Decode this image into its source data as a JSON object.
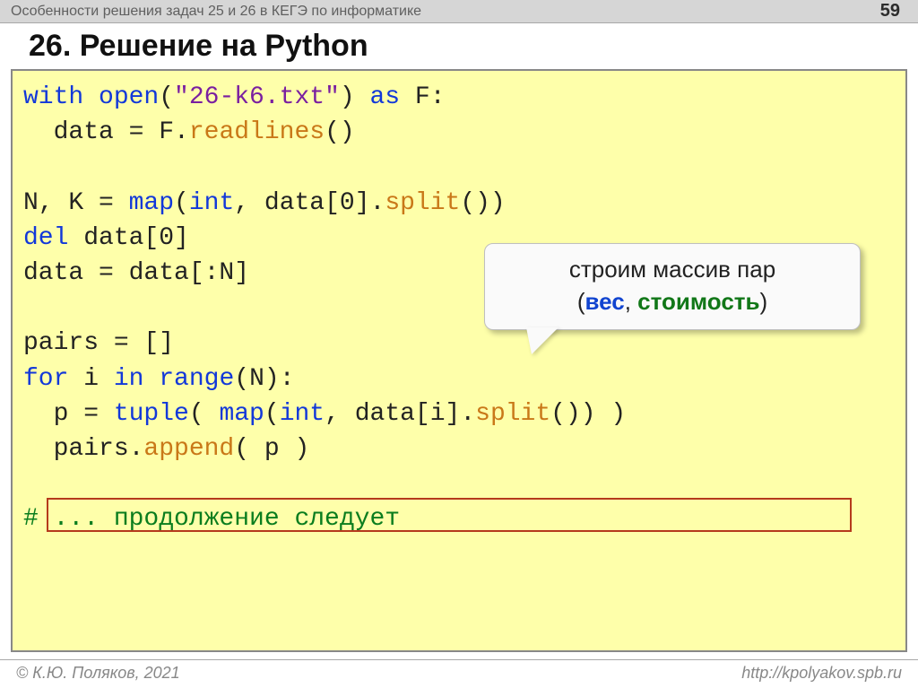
{
  "header": {
    "title": "Особенности решения задач 25 и 26 в КЕГЭ по информатике",
    "page": "59"
  },
  "title": "26. Решение на Python",
  "code": {
    "l1a": "with",
    "l1b": " open",
    "l1c": "(",
    "l1d": "\"26-k6.txt\"",
    "l1e": ")",
    "l1f": " as",
    "l1g": " F:",
    "l2a": "  data = F.",
    "l2b": "readlines",
    "l2c": "()",
    "l4a": "N, K = ",
    "l4b": "map",
    "l4c": "(",
    "l4d": "int",
    "l4e": ", data[0].",
    "l4f": "split",
    "l4g": "())",
    "l5a": "del",
    "l5b": " data[0]",
    "l6a": "data = data[:N]",
    "l8a": "pairs = []",
    "l9a": "for",
    "l9b": " i ",
    "l9c": "in",
    "l9d": " range",
    "l9e": "(N):",
    "l10a": "  p = ",
    "l10b": "tuple",
    "l10c": "( ",
    "l10d": "map",
    "l10e": "(",
    "l10f": "int",
    "l10g": ", data[i].",
    "l10h": "split",
    "l10i": "()) )",
    "l11a": "  pairs.",
    "l11b": "append",
    "l11c": "( p )",
    "l13a": "# ... продолжение следует"
  },
  "callout": {
    "line1": "строим массив пар",
    "p_open": "(",
    "w1": "вес",
    "sep": ", ",
    "w2": "стоимость",
    "p_close": ")"
  },
  "footer": {
    "left": "© К.Ю. Поляков, 2021",
    "right": "http://kpolyakov.spb.ru"
  }
}
